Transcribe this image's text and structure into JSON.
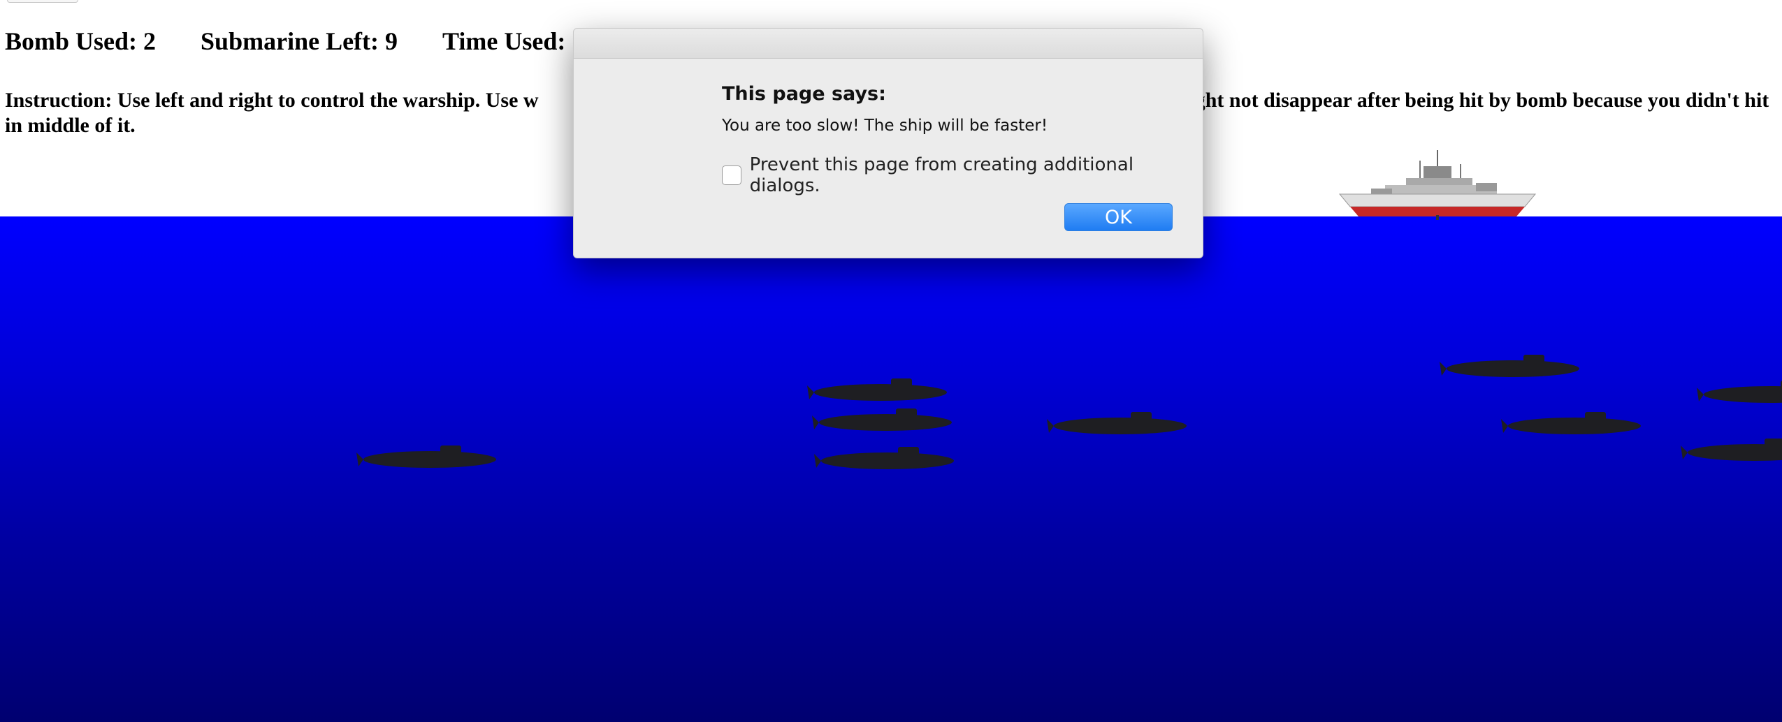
{
  "stats": {
    "bomb_used": "Bomb Used: 2",
    "submarine_left": "Submarine Left: 9",
    "time_used": "Time Used:"
  },
  "instructions": {
    "part1": "Instruction: Use left and right to control the warship. Use w",
    "part2": "e might not disappear after being hit by bomb because you didn't hit in middle of it."
  },
  "dialog": {
    "heading": "This page says:",
    "message": "You are too slow! The ship will be faster!",
    "checkbox_label": "Prevent this page from creating additional dialogs.",
    "ok_label": "OK"
  },
  "colors": {
    "ocean_top": "#0000ff",
    "ocean_bottom": "#000070",
    "dialog_bg": "#ececec",
    "ok_button": "#1f7cf2"
  },
  "icons": {
    "warship": "warship-icon",
    "submarine": "submarine-icon"
  }
}
